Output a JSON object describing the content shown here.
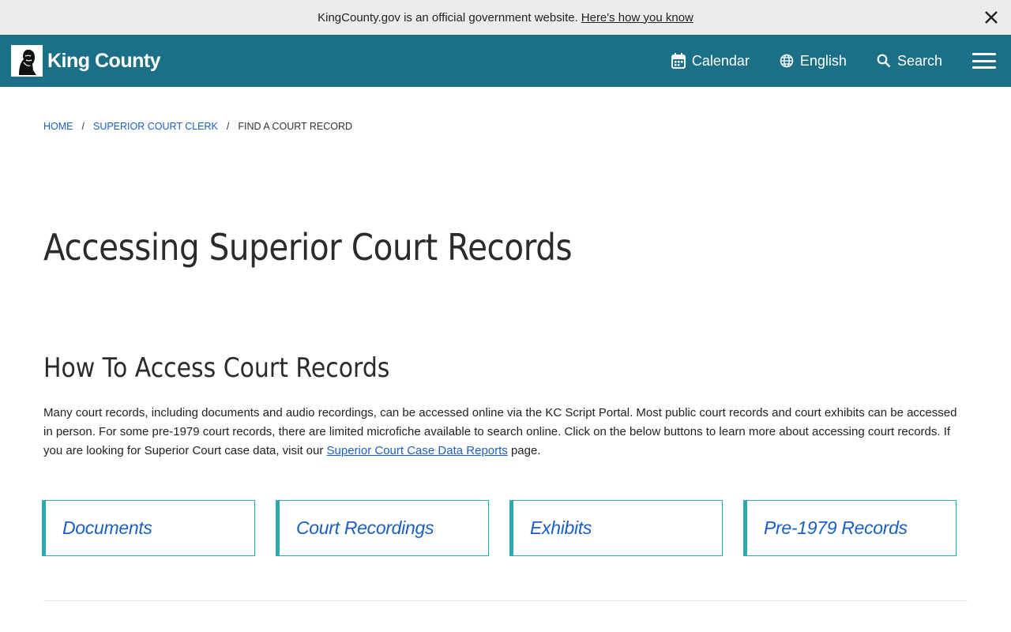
{
  "banner": {
    "text": "KingCounty.gov is an official government website.",
    "link": "Here's how you know"
  },
  "header": {
    "logo_text": "King County",
    "nav": {
      "calendar": "Calendar",
      "language": "English",
      "search": "Search"
    },
    "colors": {
      "header_bg": "#1b7088",
      "banner_bg": "#ececec"
    }
  },
  "breadcrumb": {
    "home": "HOME",
    "parent": "SUPERIOR COURT CLERK",
    "current": "FIND A COURT RECORD",
    "separator": "/"
  },
  "page": {
    "title": "Accessing Superior Court Records",
    "section_title": "How To Access Court Records",
    "intro_before": "Many court records, including documents and audio recordings, can be accessed online via the KC Script Portal. Most public court records and court exhibits can be accessed in person. For some pre-1979 court records, there are limited microfiche available to search online. Click on the below buttons to learn more about accessing court records. If you are looking for Superior Court case data, visit our ",
    "intro_link": "Superior Court Case Data Reports",
    "intro_after": " page."
  },
  "cards": [
    {
      "label": "Documents"
    },
    {
      "label": "Court Recordings"
    },
    {
      "label": "Exhibits"
    },
    {
      "label": "Pre-1979 Records"
    }
  ],
  "accent_colors": {
    "link": "#1a5fc4",
    "card_border": "#2aa8b3"
  }
}
